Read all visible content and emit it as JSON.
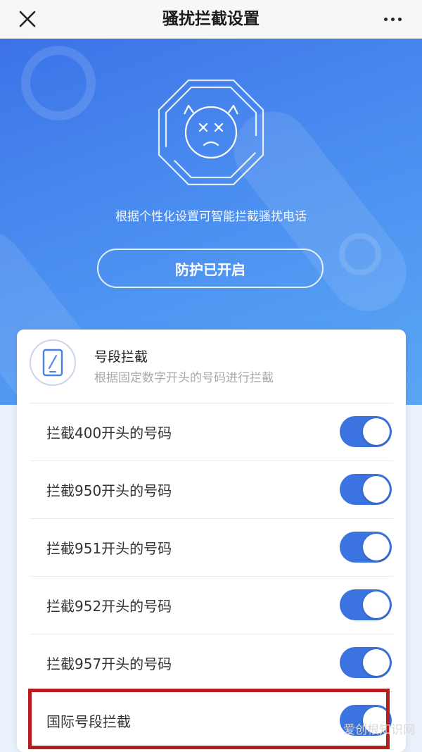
{
  "nav": {
    "title": "骚扰拦截设置",
    "close_icon": "close-icon",
    "more_icon": "more-dots-icon"
  },
  "hero": {
    "description": "根据个性化设置可智能拦截骚扰电话",
    "protect_button": "防护已开启",
    "icon": "shield-devil-face-icon",
    "gradient_colors": [
      "#3c73e8",
      "#5aa7f5"
    ]
  },
  "card": {
    "icon": "phone-icon",
    "title": "号段拦截",
    "subtitle": "根据固定数字开头的号码进行拦截",
    "rows": [
      {
        "label": "拦截400开头的号码",
        "enabled": true
      },
      {
        "label": "拦截950开头的号码",
        "enabled": true
      },
      {
        "label": "拦截951开头的号码",
        "enabled": true
      },
      {
        "label": "拦截952开头的号码",
        "enabled": true
      },
      {
        "label": "拦截957开头的号码",
        "enabled": true
      },
      {
        "label": "国际号段拦截",
        "enabled": true
      }
    ]
  },
  "colors": {
    "toggle_on": "#3b73e0",
    "highlight": "#b61d1d"
  },
  "watermark": "爱创根知识网"
}
